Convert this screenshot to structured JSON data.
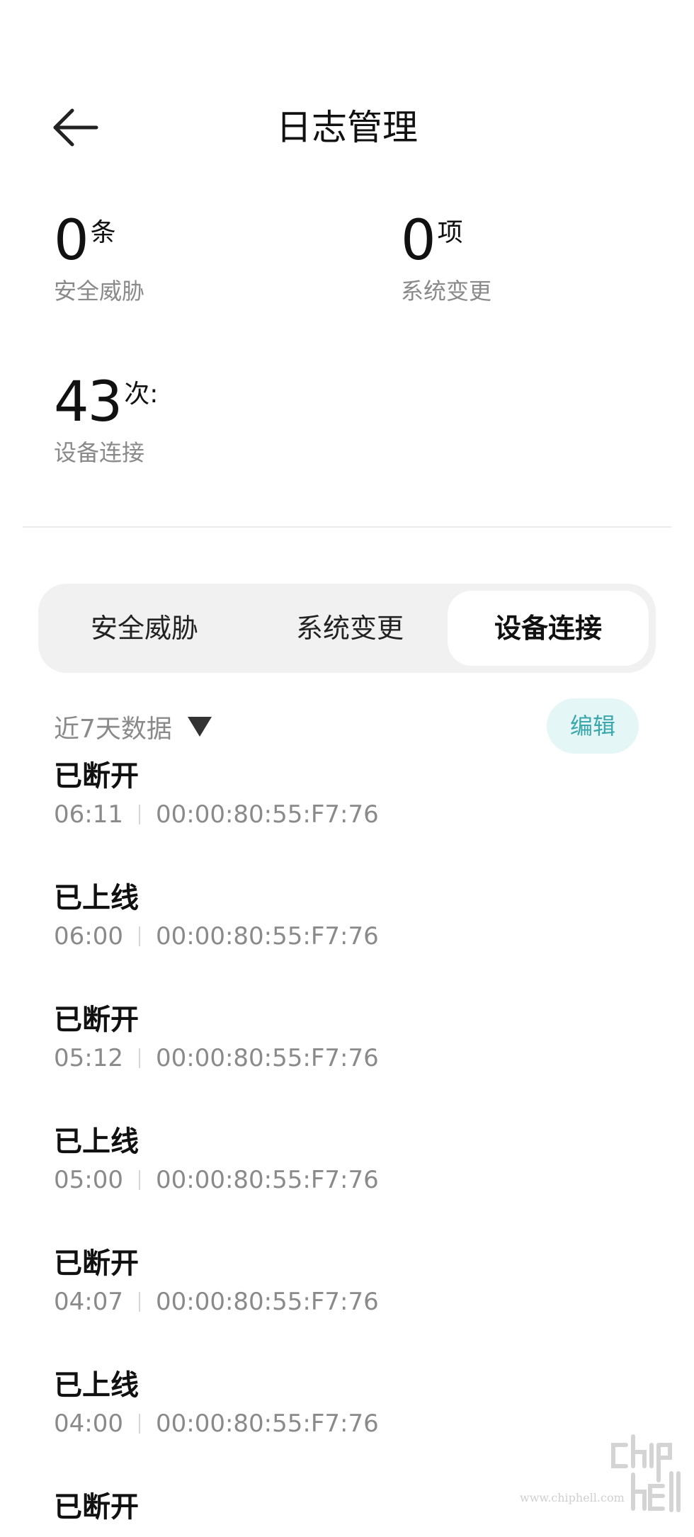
{
  "header": {
    "title": "日志管理"
  },
  "stats": {
    "threat": {
      "value": "0",
      "unit": "条",
      "label": "安全威胁"
    },
    "change": {
      "value": "0",
      "unit": "项",
      "label": "系统变更"
    },
    "connection": {
      "value": "43",
      "unit": "次:",
      "label": "设备连接"
    }
  },
  "tabs": [
    {
      "label": "安全威胁",
      "selected": false
    },
    {
      "label": "系统变更",
      "selected": false
    },
    {
      "label": "设备连接",
      "selected": true
    }
  ],
  "filter": {
    "label": "近7天数据"
  },
  "edit_label": "编辑",
  "colors": {
    "accent": "#3aa7ad",
    "accent_bg": "#e5f6f6",
    "secondary_text": "#8a8a8a"
  },
  "logs": [
    {
      "status": "已断开",
      "time": "06:11",
      "mac": "00:00:80:55:F7:76"
    },
    {
      "status": "已上线",
      "time": "06:00",
      "mac": "00:00:80:55:F7:76"
    },
    {
      "status": "已断开",
      "time": "05:12",
      "mac": "00:00:80:55:F7:76"
    },
    {
      "status": "已上线",
      "time": "05:00",
      "mac": "00:00:80:55:F7:76"
    },
    {
      "status": "已断开",
      "time": "04:07",
      "mac": "00:00:80:55:F7:76"
    },
    {
      "status": "已上线",
      "time": "04:00",
      "mac": "00:00:80:55:F7:76"
    },
    {
      "status": "已断开",
      "time": "",
      "mac": ""
    }
  ],
  "watermark": {
    "text": "www.chiphell.com"
  }
}
